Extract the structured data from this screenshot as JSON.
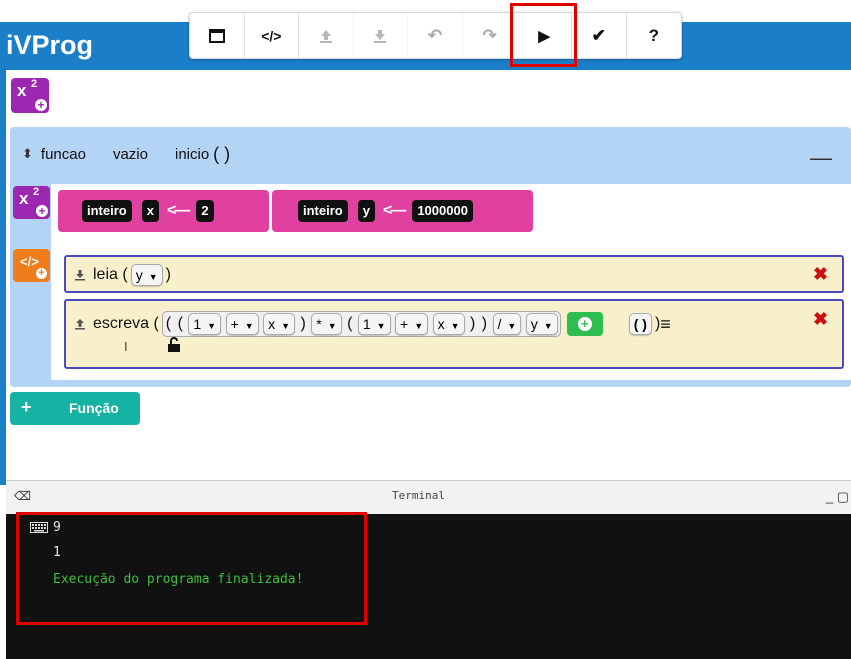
{
  "app": {
    "title": "iVProg"
  },
  "toolbar": {
    "buttons": [
      {
        "name": "visual-mode",
        "icon": "window-icon",
        "glyph": "▬",
        "enabled": true
      },
      {
        "name": "code-mode",
        "icon": "code-icon",
        "glyph": "</>",
        "enabled": true
      },
      {
        "name": "upload",
        "icon": "upload-icon",
        "glyph": "⭱",
        "enabled": false
      },
      {
        "name": "download",
        "icon": "download-icon",
        "glyph": "⭳",
        "enabled": false
      },
      {
        "name": "undo",
        "icon": "undo-icon",
        "glyph": "↶",
        "enabled": false
      },
      {
        "name": "redo",
        "icon": "redo-icon",
        "glyph": "↷",
        "enabled": false
      },
      {
        "name": "run",
        "icon": "play-icon",
        "glyph": "▶",
        "enabled": true
      },
      {
        "name": "check",
        "icon": "check-icon",
        "glyph": "✔",
        "enabled": true
      },
      {
        "name": "help",
        "icon": "help-icon",
        "glyph": "?",
        "enabled": true
      }
    ]
  },
  "globals": {
    "add_icon": "x²+"
  },
  "function": {
    "keyword": "funcao",
    "return_type": "vazio",
    "name": "inicio",
    "parens": "( )",
    "minimize": "—"
  },
  "variables": [
    {
      "type": "inteiro",
      "name": "x",
      "arrow": "<—",
      "value": "2"
    },
    {
      "type": "inteiro",
      "name": "y",
      "arrow": "<—",
      "value": "1000000"
    }
  ],
  "commands": {
    "read": {
      "label": "leia (",
      "var": "y",
      "close": ")"
    },
    "write": {
      "label": "escreva (",
      "tokens": [
        "(",
        "(",
        "1",
        "+",
        "x",
        ")",
        "*",
        "(",
        "1",
        "+",
        "x",
        ")",
        ")",
        "/",
        "y"
      ],
      "extra": "( )",
      "close": ")"
    }
  },
  "add_function": {
    "label": "Função",
    "plus": "+"
  },
  "terminal": {
    "title": "Terminal",
    "lines": [
      {
        "text": "9",
        "kind": "input"
      },
      {
        "text": "1",
        "kind": "output"
      },
      {
        "text": "Execução do programa finalizada!",
        "kind": "info"
      }
    ],
    "controls": "_ ▢"
  },
  "colors": {
    "header": "#1b7fc8",
    "function_bg": "#b3d4f5",
    "var_decl": "#e040a0",
    "var_icon": "#9c27b0",
    "code_icon": "#f07d1c",
    "command_bg": "#f8f0cb",
    "add_function": "#16b2a3",
    "terminal_bg": "#111111",
    "terminal_info": "#3cbf3c",
    "highlight": "#e00000"
  }
}
